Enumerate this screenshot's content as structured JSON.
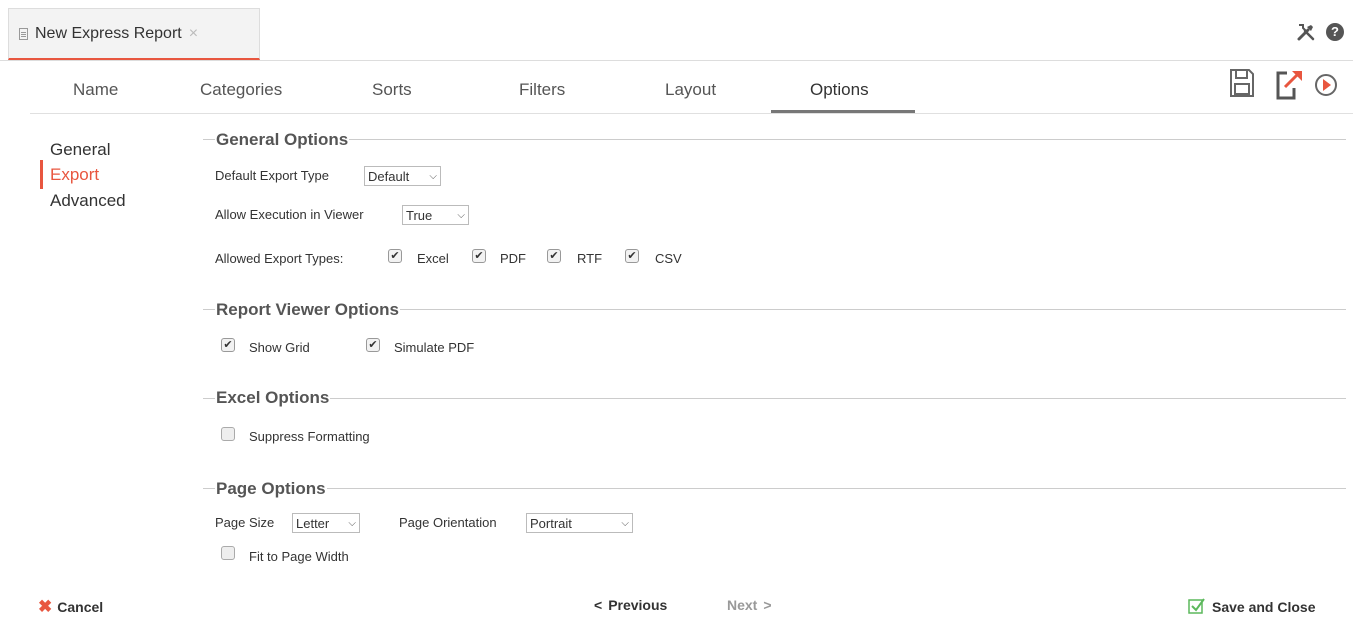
{
  "window": {
    "tab_title": "New Express Report",
    "tab_close": "×",
    "help_glyph": "?"
  },
  "steps": [
    {
      "label": "Name"
    },
    {
      "label": "Categories"
    },
    {
      "label": "Sorts"
    },
    {
      "label": "Filters"
    },
    {
      "label": "Layout"
    },
    {
      "label": "Options",
      "active": true
    }
  ],
  "header_icons": [
    "save-icon",
    "export-icon",
    "run-icon"
  ],
  "nav": {
    "items": [
      {
        "label": "General"
      },
      {
        "label": "Export",
        "active": true
      },
      {
        "label": "Advanced"
      }
    ]
  },
  "general_options": {
    "title": "General Options",
    "default_export_type_label": "Default Export Type",
    "default_export_type_value": "Default",
    "allow_execution_label": "Allow Execution in Viewer",
    "allow_execution_value": "True",
    "allowed_export_types_label": "Allowed Export Types:",
    "export_types": [
      {
        "label": "Excel",
        "checked": true
      },
      {
        "label": "PDF",
        "checked": true
      },
      {
        "label": "RTF",
        "checked": true
      },
      {
        "label": "CSV",
        "checked": true
      }
    ]
  },
  "report_viewer_options": {
    "title": "Report Viewer Options",
    "show_grid_label": "Show Grid",
    "show_grid_checked": true,
    "simulate_pdf_label": "Simulate PDF",
    "simulate_pdf_checked": true
  },
  "excel_options": {
    "title": "Excel Options",
    "suppress_formatting_label": "Suppress Formatting",
    "suppress_formatting_checked": false
  },
  "page_options": {
    "title": "Page Options",
    "page_size_label": "Page Size",
    "page_size_value": "Letter",
    "page_orientation_label": "Page Orientation",
    "page_orientation_value": "Portrait",
    "fit_to_page_width_label": "Fit to Page Width",
    "fit_to_page_width_checked": false
  },
  "footer": {
    "cancel_label": "Cancel",
    "previous_label": "Previous",
    "next_label": "Next",
    "save_close_label": "Save and Close"
  },
  "colors": {
    "accent": "#e8563f",
    "save_check": "#5cb85c"
  }
}
